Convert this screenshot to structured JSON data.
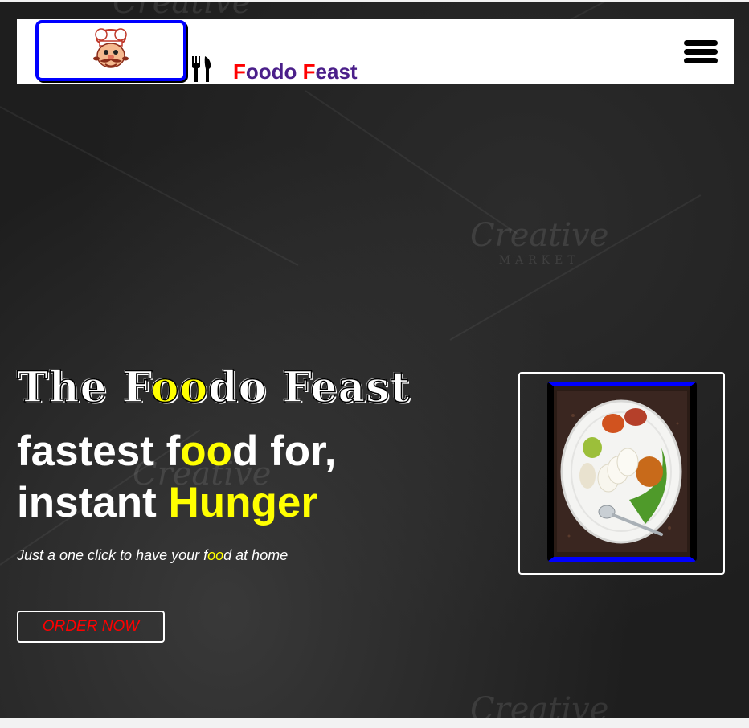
{
  "brand": {
    "name_part1_initial": "F",
    "name_part1_rest": "oodo ",
    "name_part2_initial": "F",
    "name_part2_rest": "east"
  },
  "hero": {
    "title_pre": "The F",
    "title_highlight": "oo",
    "title_post": "do Feast",
    "headline_line1_pre": "fastest f",
    "headline_line1_highlight": "oo",
    "headline_line1_post": "d for,",
    "headline_line2_pre": "instant ",
    "headline_line2_highlight": "Hunger",
    "tagline_pre": "Just a one click to have your f",
    "tagline_highlight": "oo",
    "tagline_post": "d at home",
    "order_button": "ORDER NOW"
  },
  "watermarks": {
    "main": "Creative",
    "sub": "MARKET"
  },
  "icons": {
    "logo": "chef-mascot-icon",
    "fork_knife": "fork-knife-icon",
    "menu": "hamburger-menu-icon",
    "dish": "idli-plate-image"
  },
  "colors": {
    "accent_yellow": "#ffff00",
    "brand_red": "#ff0000",
    "brand_purple": "#4b1f8a",
    "frame_blue": "#0000ff",
    "background": "#1e1e1e"
  }
}
